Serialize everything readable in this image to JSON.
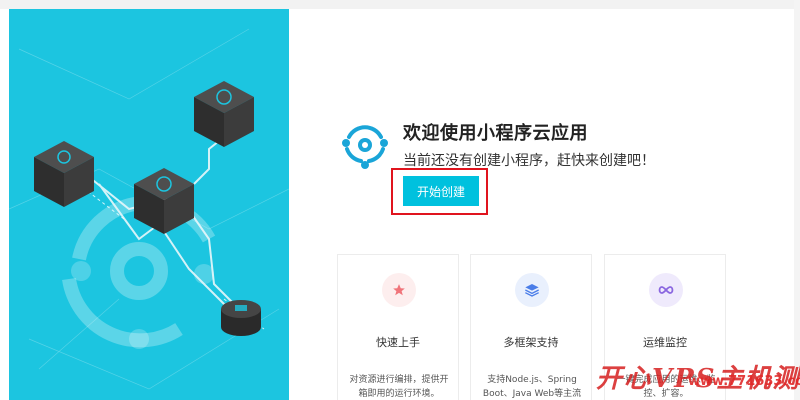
{
  "welcome": {
    "title": "欢迎使用小程序云应用",
    "subtitle": "当前还没有创建小程序，赶快来创建吧！",
    "create_button": "开始创建"
  },
  "cards": [
    {
      "title": "快速上手",
      "desc": "对资源进行编排，提供开箱即用的运行环境。",
      "icon": "star-icon",
      "icon_color": "#f0747a",
      "icon_bg": "#fdeeee"
    },
    {
      "title": "多框架支持",
      "desc": "支持Node.js、Spring Boot、Java Web等主流框架的部署。",
      "icon": "layers-icon",
      "icon_color": "#4a7de8",
      "icon_bg": "#e9f0fd"
    },
    {
      "title": "运维监控",
      "desc": "一键完成应用的运维、监控、扩容。",
      "icon": "infinity-icon",
      "icon_color": "#8a66e0",
      "icon_bg": "#efeafc"
    }
  ],
  "watermark": {
    "text": "开心VPS主机测评",
    "url": "www.771633.com"
  },
  "colors": {
    "hero_bg": "#1cc5e0",
    "button_bg": "#00c1de",
    "highlight_border": "#e0141e",
    "logo_blue": "#1aa5d8"
  }
}
